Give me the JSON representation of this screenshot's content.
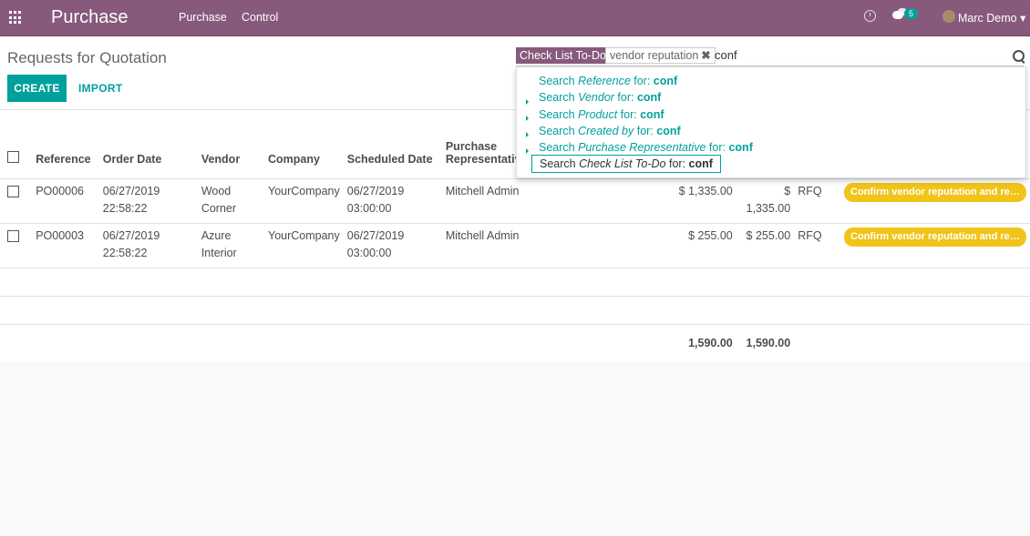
{
  "topbar": {
    "app_name": "Purchase",
    "menu": [
      "Purchase",
      "Control"
    ],
    "chat_count": "5",
    "user_name": "Marc Demo ▾"
  },
  "page": {
    "title": "Requests for Quotation",
    "create_label": "CREATE",
    "import_label": "IMPORT"
  },
  "search": {
    "facet_category": "Check List To-Do",
    "facet_value": "vendor reputation",
    "facet_remove": "✖",
    "query": "conf",
    "suggestions": [
      {
        "prefix": "Search ",
        "field": "Reference",
        "suffix": " for: ",
        "term": "conf"
      },
      {
        "prefix": "Search ",
        "field": "Vendor",
        "suffix": " for: ",
        "term": "conf"
      },
      {
        "prefix": "Search ",
        "field": "Product",
        "suffix": " for: ",
        "term": "conf"
      },
      {
        "prefix": "Search ",
        "field": "Created by",
        "suffix": " for: ",
        "term": "conf"
      },
      {
        "prefix": "Search ",
        "field": "Purchase Representative",
        "suffix": " for: ",
        "term": "conf"
      },
      {
        "prefix": "Search ",
        "field": "Check List To-Do",
        "suffix": " for: ",
        "term": "conf"
      }
    ]
  },
  "table": {
    "headers": {
      "reference": "Reference",
      "order_date": "Order Date",
      "vendor": "Vendor",
      "company": "Company",
      "scheduled_date": "Scheduled Date",
      "representative_line1": "Purchase",
      "representative_line2": "Representative"
    },
    "rows": [
      {
        "reference": "PO00006",
        "order_date": "06/27/2019",
        "order_time": "22:58:22",
        "vendor": "Wood Corner",
        "company": "YourCompany",
        "scheduled_date": "06/27/2019",
        "scheduled_time": "03:00:00",
        "representative": "Mitchell Admin",
        "untaxed": "$ 1,335.00",
        "total": "$ 1,335.00",
        "status": "RFQ",
        "todo": "Confirm vendor reputation and relia…"
      },
      {
        "reference": "PO00003",
        "order_date": "06/27/2019",
        "order_time": "22:58:22",
        "vendor": "Azure",
        "vendor2": "Interior",
        "company": "YourCompany",
        "scheduled_date": "06/27/2019",
        "scheduled_time": "03:00:00",
        "representative": "Mitchell Admin",
        "untaxed": "$ 255.00",
        "total": "$ 255.00",
        "status": "RFQ",
        "todo": "Confirm vendor reputation and relia…"
      }
    ],
    "totals": {
      "untaxed": "1,590.00",
      "total": "1,590.00"
    }
  },
  "colors": {
    "brand": "#875a7b",
    "accent": "#00a09d",
    "pill": "#f0c419"
  }
}
